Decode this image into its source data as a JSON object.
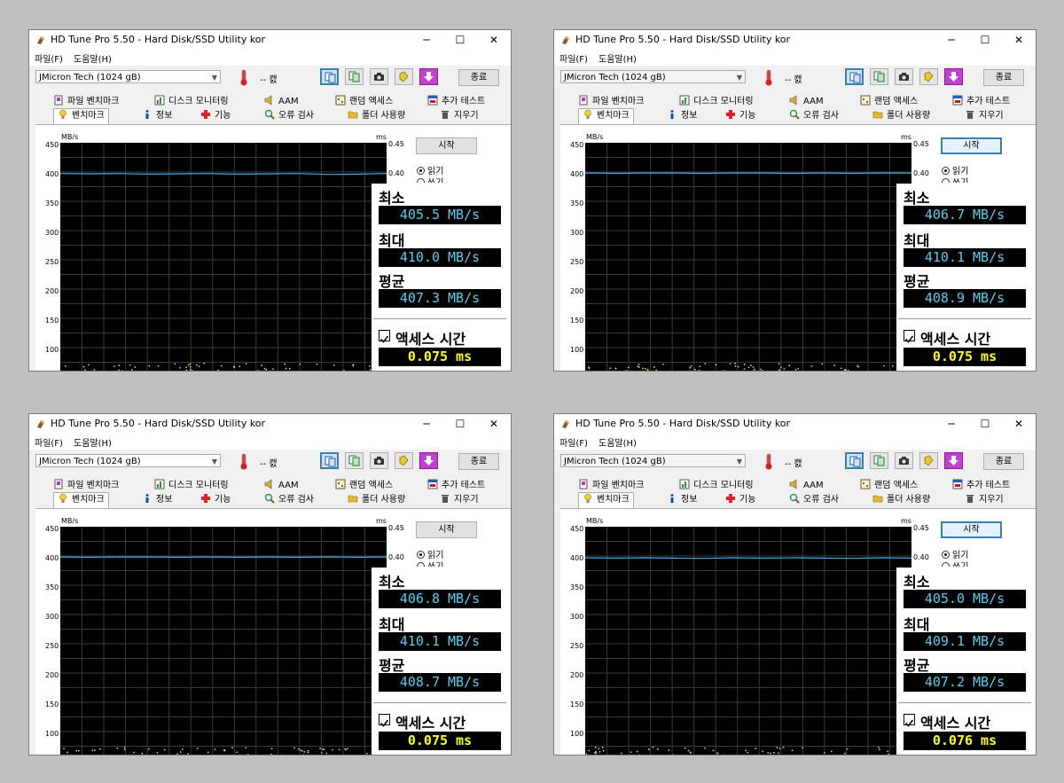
{
  "common": {
    "title": "HD Tune Pro 5.50 - Hard Disk/SSD Utility kor",
    "menu_file": "파일(F)",
    "menu_help": "도움말(H)",
    "drive": "JMicron Tech (1024 gB)",
    "temperature": "-- 캜",
    "exit_label": "종료",
    "window_controls": {
      "minimize": "─",
      "maximize": "☐",
      "close": "✕"
    },
    "tabs_top": [
      "파일 벤치마크",
      "디스크 모니터링",
      "AAM",
      "랜덤 액세스",
      "추가 테스트"
    ],
    "tabs_bottom": [
      "벤치마크",
      "정보",
      "기능",
      "오류 검사",
      "폴더 사용량",
      "지우기"
    ],
    "start_label": "시작",
    "read_label": "읽기",
    "write_label": "쓰기",
    "y_unit": "MB/s",
    "r_unit": "ms",
    "y_ticks": [
      "450",
      "400",
      "350",
      "300",
      "250",
      "200",
      "150",
      "100"
    ],
    "r_ticks": [
      "0.45",
      "0.40"
    ],
    "min_label": "최소",
    "max_label": "최대",
    "avg_label": "평균",
    "access_label": "액세스 시간",
    "icons": [
      "app-icon",
      "thermometer-icon",
      "copy-icon",
      "save-icon",
      "camera-icon",
      "bookmark-icon",
      "download-icon"
    ]
  },
  "windows": [
    {
      "min": "405.5 MB/s",
      "max": "410.0 MB/s",
      "avg": "407.3 MB/s",
      "access": "0.075 ms"
    },
    {
      "min": "406.7 MB/s",
      "max": "410.1 MB/s",
      "avg": "408.9 MB/s",
      "access": "0.075 ms"
    },
    {
      "min": "406.8 MB/s",
      "max": "410.1 MB/s",
      "avg": "408.7 MB/s",
      "access": "0.075 ms"
    },
    {
      "min": "405.0 MB/s",
      "max": "409.1 MB/s",
      "avg": "407.2 MB/s",
      "access": "0.076 ms"
    }
  ],
  "chart_data": [
    {
      "type": "line",
      "ylabel": "MB/s",
      "ylim": [
        100,
        450
      ],
      "series": [
        {
          "name": "읽기",
          "values": [
            408,
            407.5,
            408,
            407,
            407.5,
            408,
            407,
            407.5,
            408,
            406.5,
            407,
            408
          ]
        }
      ]
    },
    {
      "type": "line",
      "ylabel": "MB/s",
      "ylim": [
        100,
        450
      ],
      "series": [
        {
          "name": "읽기",
          "values": [
            409,
            408.5,
            409,
            409,
            408.5,
            409,
            409,
            408.5,
            409,
            408.5,
            409,
            409
          ]
        }
      ]
    },
    {
      "type": "line",
      "ylabel": "MB/s",
      "ylim": [
        100,
        450
      ],
      "series": [
        {
          "name": "읽기",
          "values": [
            409,
            408.5,
            409,
            409,
            408.5,
            409,
            408.5,
            409,
            408.5,
            409,
            408.5,
            409
          ]
        }
      ]
    },
    {
      "type": "line",
      "ylabel": "MB/s",
      "ylim": [
        100,
        450
      ],
      "series": [
        {
          "name": "읽기",
          "values": [
            407.5,
            407,
            407.5,
            407,
            406.5,
            407.5,
            407,
            407.5,
            407,
            406.5,
            407.5,
            407
          ]
        }
      ]
    }
  ]
}
